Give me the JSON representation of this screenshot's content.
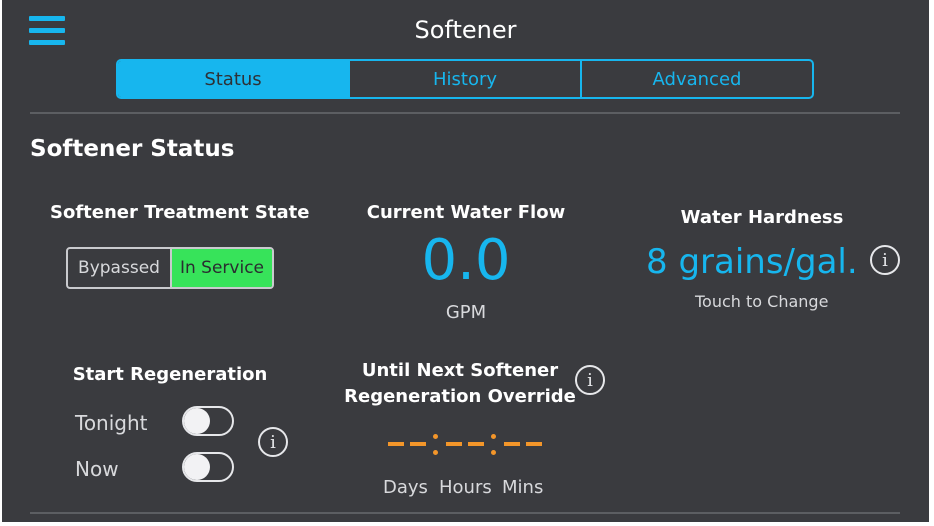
{
  "header": {
    "title": "Softener",
    "tabs": [
      {
        "label": "Status",
        "active": true
      },
      {
        "label": "History",
        "active": false
      },
      {
        "label": "Advanced",
        "active": false
      }
    ]
  },
  "status": {
    "section_title": "Softener Status",
    "treatment_state": {
      "label": "Softener Treatment State",
      "options": [
        "Bypassed",
        "In Service"
      ],
      "selected": "In Service"
    },
    "water_flow": {
      "label": "Current Water Flow",
      "value": "0.0",
      "unit": "GPM"
    },
    "water_hardness": {
      "label": "Water Hardness",
      "value": "8 grains/gal.",
      "hint": "Touch to Change"
    },
    "regeneration": {
      "label": "Start Regeneration",
      "options": [
        {
          "label": "Tonight",
          "on": false
        },
        {
          "label": "Now",
          "on": false
        }
      ]
    },
    "override": {
      "label_line1": "Until Next Softener",
      "label_line2": "Regeneration Override",
      "units": [
        "Days",
        "Hours",
        "Mins"
      ]
    }
  },
  "colors": {
    "accent": "#17b6ee",
    "background": "#3a3b3f",
    "in_service": "#37e35a",
    "countdown": "#f3962a"
  },
  "icons": {
    "menu": "hamburger-menu-icon",
    "info": "info-circle-icon"
  }
}
